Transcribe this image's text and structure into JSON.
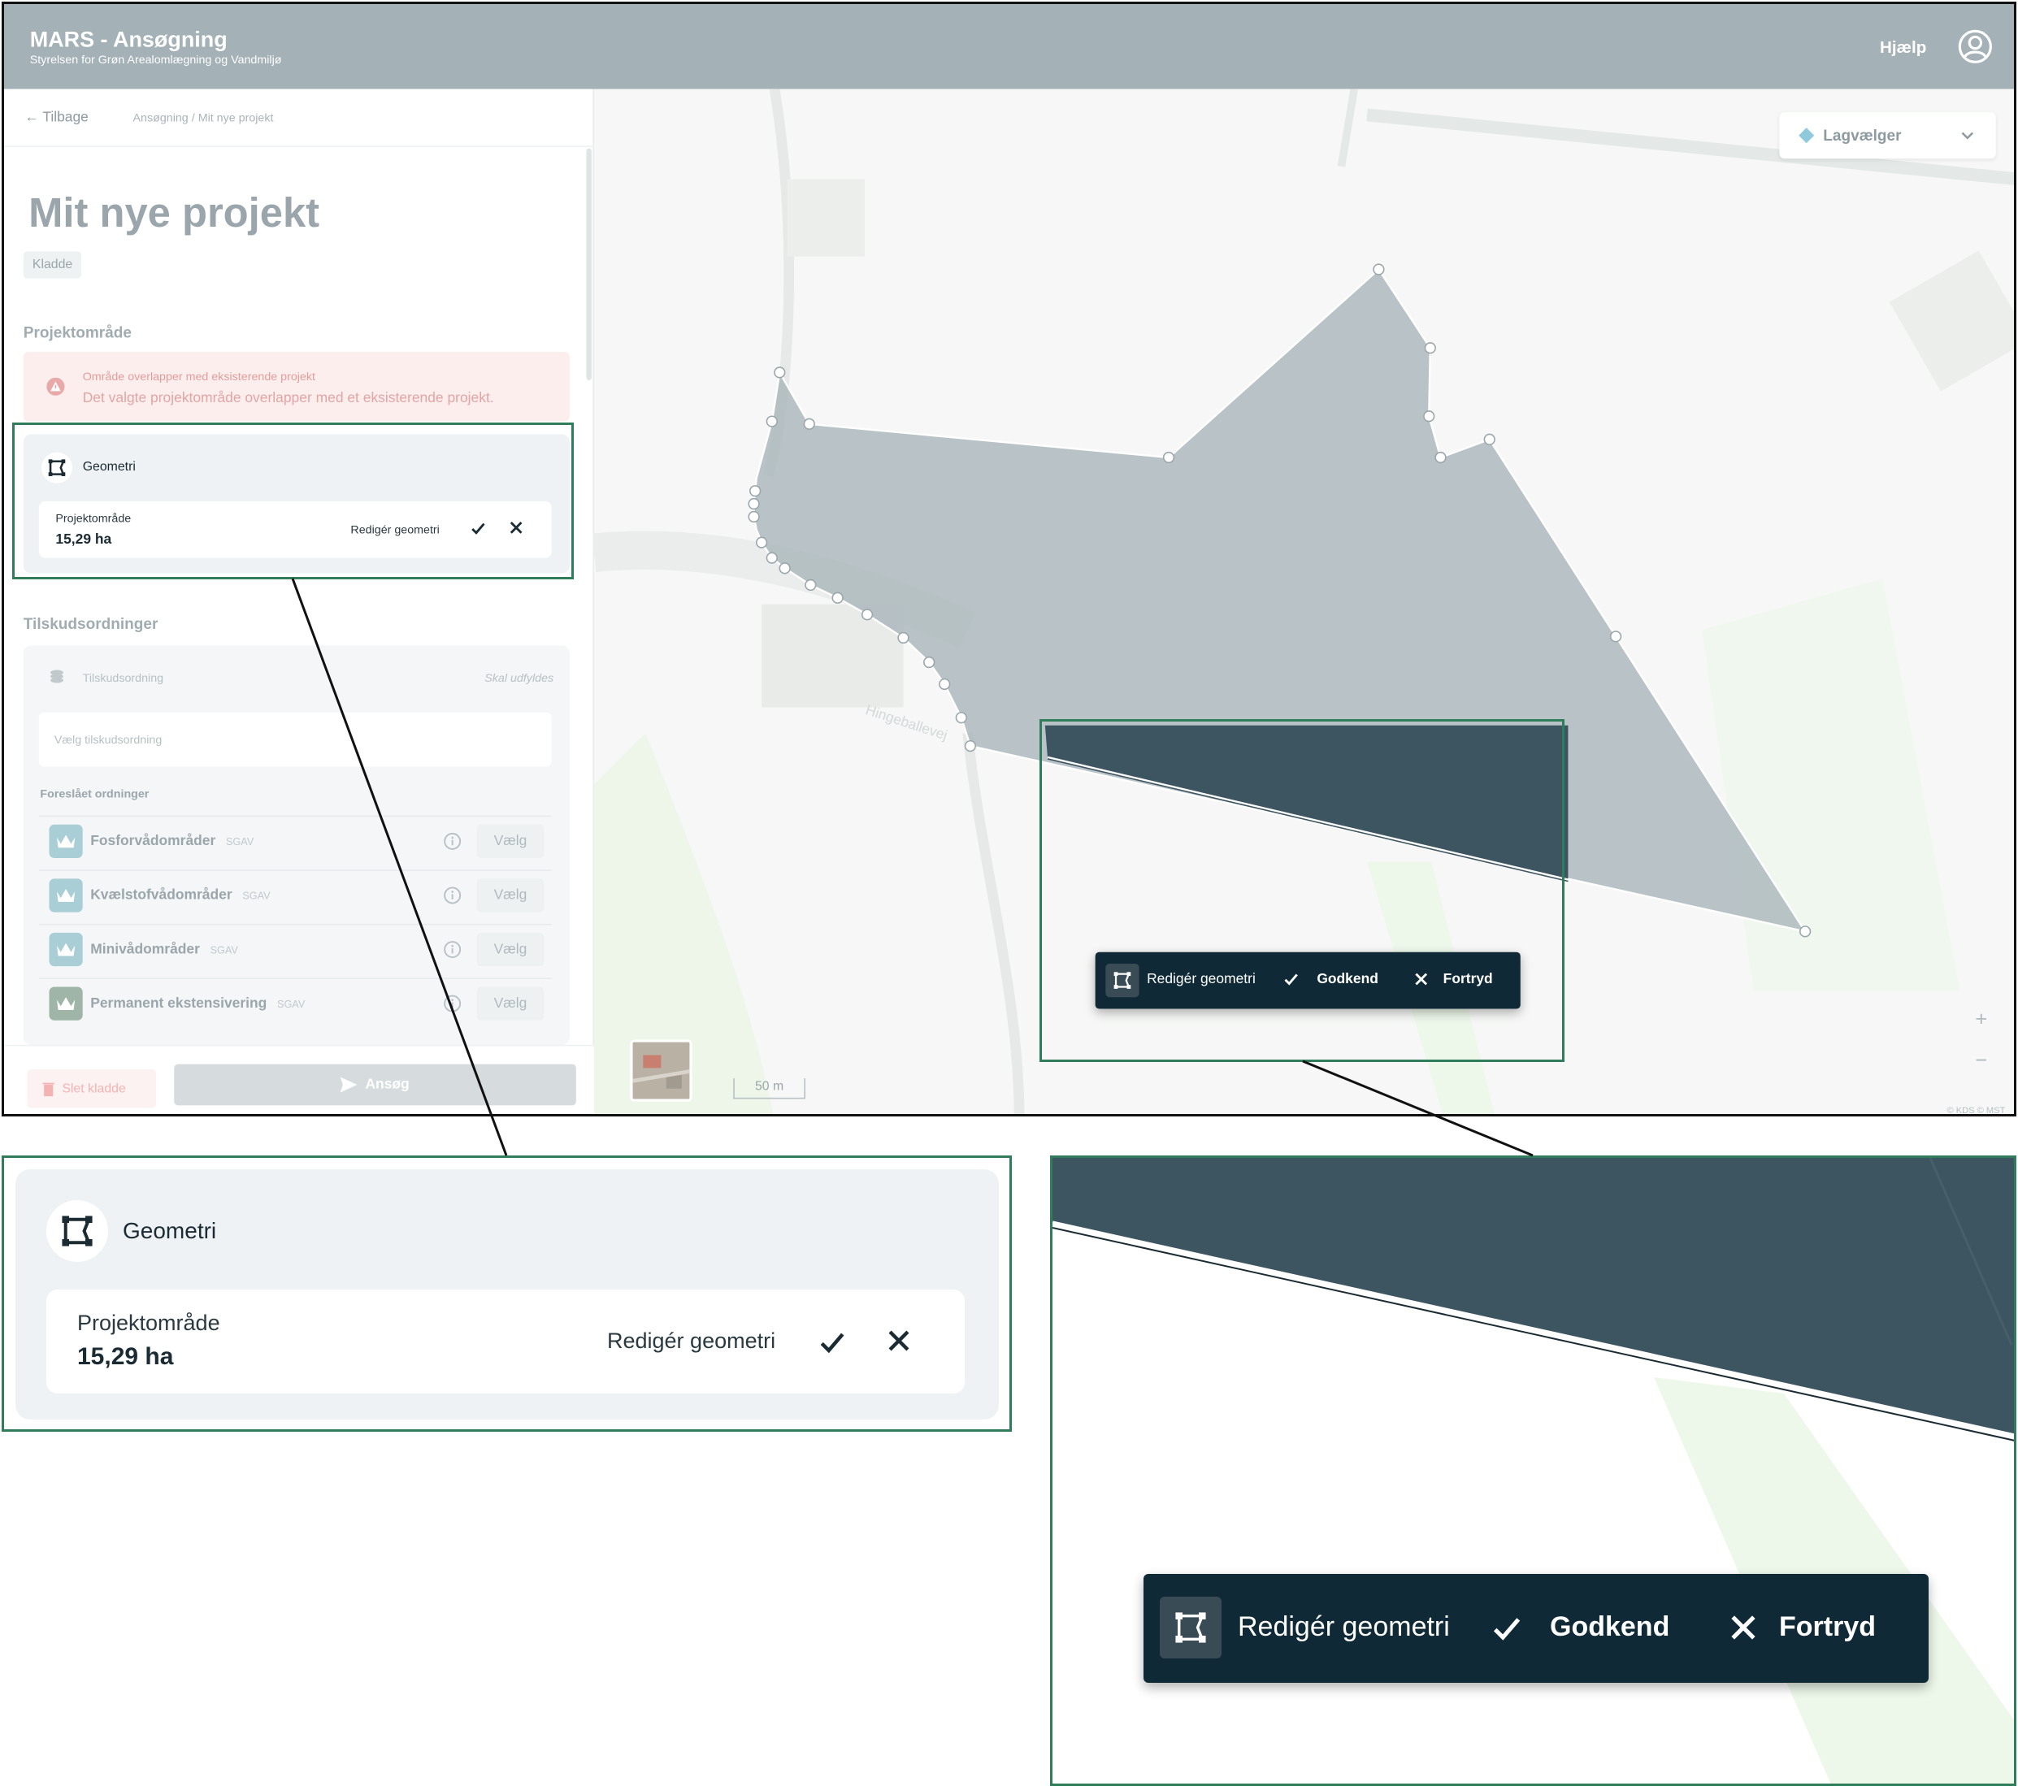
{
  "app": {
    "title": "MARS - Ansøgning",
    "subtitle": "Styrelsen for Grøn Arealomlægning og Vandmiljø",
    "help": "Hjælp"
  },
  "nav": {
    "back": "Tilbage",
    "crumb1": "Ansøgning",
    "crumb_sep": "/",
    "crumb2": "Mit nye projekt"
  },
  "project": {
    "title": "Mit nye projekt",
    "status": "Kladde"
  },
  "area_section": {
    "heading": "Projektområde",
    "alert_title": "Område overlapper med eksisterende projekt",
    "alert_text": "Det valgte projektområde overlapper med et eksisterende projekt."
  },
  "geometry": {
    "heading": "Geometri",
    "area_label": "Projektområde",
    "area_value": "15,29 ha",
    "edit_label": "Redigér geometri"
  },
  "grants": {
    "heading": "Tilskudsordninger",
    "card_title": "Tilskudsordning",
    "required": "Skal udfyldes",
    "select_placeholder": "Vælg tilskudsordning",
    "suggested_heading": "Foreslået ordninger",
    "options": [
      {
        "name": "Fosforvådområder",
        "source": "SGAV",
        "action": "Vælg"
      },
      {
        "name": "Kvælstofvådområder",
        "source": "SGAV",
        "action": "Vælg"
      },
      {
        "name": "Minivådområder",
        "source": "SGAV",
        "action": "Vælg"
      },
      {
        "name": "Permanent ekstensivering",
        "source": "SGAV",
        "action": "Vælg"
      }
    ]
  },
  "footer": {
    "delete": "Slet kladde",
    "apply": "Ansøg"
  },
  "map": {
    "layer_picker": "Lagvælger",
    "zoom_in": "+",
    "zoom_out": "−",
    "scale": "50 m",
    "road_name": "Hingeballevej",
    "credit": "© KDS © MST",
    "polygon_color": "#a4b1b7"
  },
  "edit_toolbar": {
    "edit": "Redigér geometri",
    "approve": "Godkend",
    "undo": "Fortryd"
  },
  "colors": {
    "header": "#a4b1b7",
    "toolbar": "#0f2a36",
    "callout_border": "#2f7d5b",
    "zoom_fill": "#3d5560"
  }
}
